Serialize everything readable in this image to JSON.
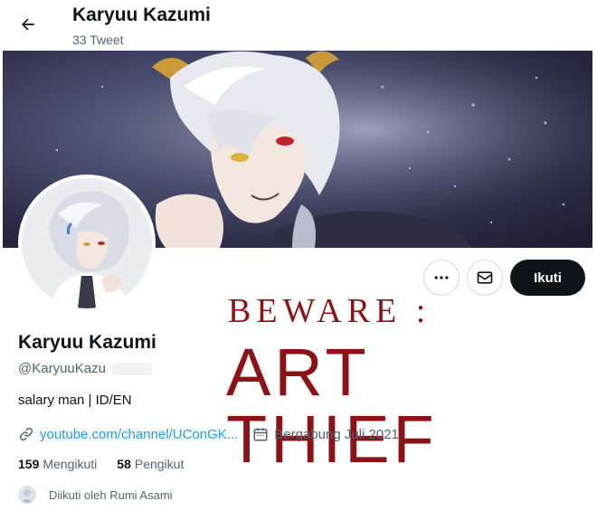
{
  "header": {
    "title": "Karyuu Kazumi",
    "tweet_count": "33 Tweet"
  },
  "overlay": {
    "line1": "BEWARE :",
    "line2": "ART THIEF",
    "color": "#8b1318"
  },
  "profile": {
    "display_name": "Karyuu Kazumi",
    "handle": "@KaryuuKazu",
    "bio": "salary man | ID/EN",
    "link_text": "youtube.com/channel/UConGK...",
    "joined": "Bergabung Juli 2021",
    "following_count": "159",
    "following_label": "Mengikuti",
    "followers_count": "58",
    "followers_label": "Pengikut",
    "followed_by": "Diikuti oleh Rumi Asami"
  },
  "actions": {
    "follow_label": "Ikuti"
  },
  "colors": {
    "accent_link": "#1d9bf0",
    "button_dark": "#0f1419",
    "muted_text": "#536471"
  },
  "icons": [
    "back-arrow-icon",
    "more-icon",
    "mail-icon",
    "link-icon",
    "calendar-icon"
  ]
}
